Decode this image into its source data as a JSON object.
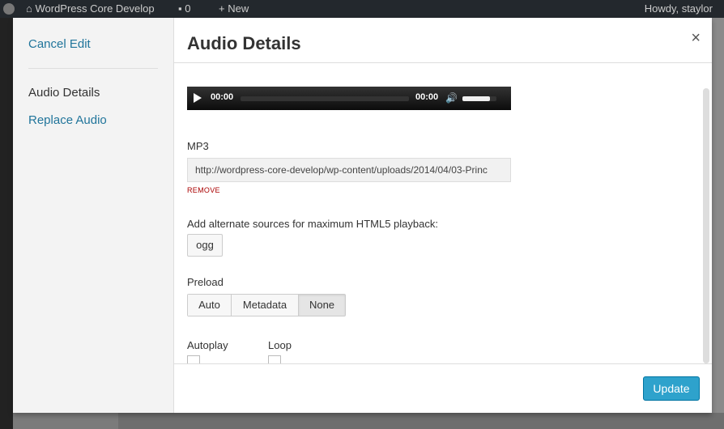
{
  "adminbar": {
    "site_name": "WordPress Core Develop",
    "comments_count": "0",
    "new_label": "New",
    "howdy": "Howdy, staylor"
  },
  "menu": {
    "cancel_label": "Cancel Edit",
    "active_label": "Audio Details",
    "replace_label": "Replace Audio"
  },
  "modal": {
    "title": "Audio Details",
    "close_symbol": "×"
  },
  "player": {
    "current_time": "00:00",
    "duration": "00:00",
    "volume_level": 0.8
  },
  "source": {
    "label": "MP3",
    "url": "http://wordpress-core-develop/wp-content/uploads/2014/04/03-Princ",
    "remove_label": "REMOVE"
  },
  "alternate": {
    "label": "Add alternate sources for maximum HTML5 playback:",
    "button": "ogg"
  },
  "preload": {
    "label": "Preload",
    "options": [
      "Auto",
      "Metadata",
      "None"
    ],
    "selected": "None"
  },
  "options": {
    "autoplay_label": "Autoplay",
    "loop_label": "Loop"
  },
  "toolbar": {
    "update_label": "Update"
  },
  "colors": {
    "primary": "#2ea2cc",
    "link": "#21759b",
    "remove": "#aa0000"
  }
}
